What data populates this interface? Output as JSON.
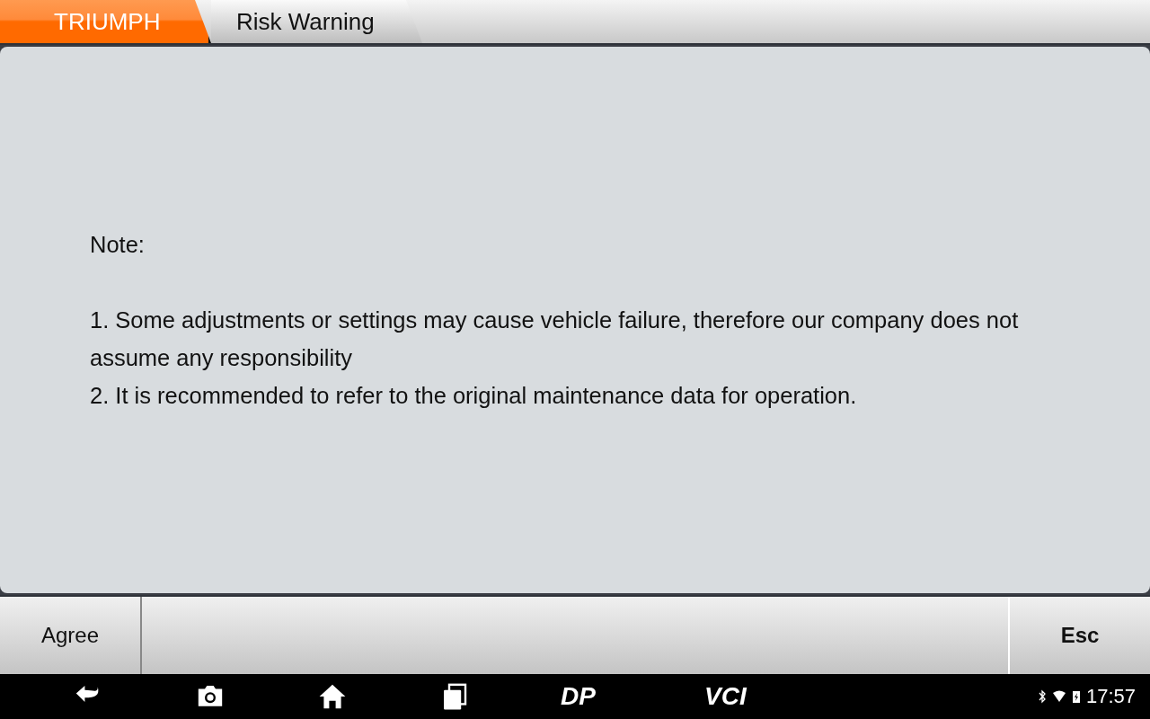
{
  "breadcrumb": [
    {
      "label": "TRIUMPH",
      "kind": "brand"
    },
    {
      "label": "Risk Warning",
      "kind": "page"
    }
  ],
  "message": {
    "heading": "Note:",
    "lines": [
      "1. Some adjustments or settings may cause vehicle failure,  therefore our company does not assume any responsibility",
      "2. It is recommended to refer to the original maintenance data for operation."
    ]
  },
  "buttons": [
    {
      "label": "Agree",
      "kind": "normal"
    },
    {
      "label": "Esc",
      "kind": "primary"
    }
  ],
  "nav_bar": {
    "items": [
      {
        "kind": "back"
      },
      {
        "kind": "camera"
      },
      {
        "kind": "home"
      },
      {
        "kind": "recents"
      },
      {
        "kind": "logo",
        "label": "DP"
      },
      {
        "kind": "logo",
        "label": "VCI"
      }
    ],
    "time": "17:57"
  }
}
